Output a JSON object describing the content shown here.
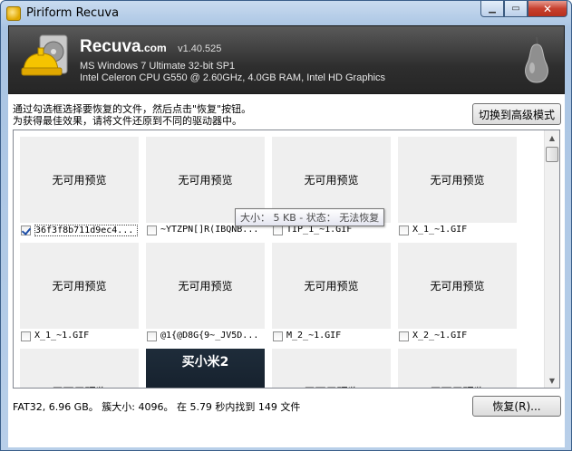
{
  "window": {
    "title": "Piriform Recuva"
  },
  "header": {
    "brand_name": "Recuva",
    "brand_domain": ".com",
    "version": "v1.40.525",
    "os_line": "MS Windows 7 Ultimate 32-bit SP1",
    "hw_line": "Intel Celeron CPU G550 @ 2.60GHz, 4.0GB RAM, Intel HD Graphics"
  },
  "instructions": {
    "line1": "通过勾选框选择要恢复的文件，然后点击\"恢复\"按钮。",
    "line2": "为获得最佳效果，请将文件还原到不同的驱动器中。"
  },
  "advanced_button_label": "切换到高级模式",
  "tiles": [
    {
      "preview": "无可用预览",
      "filename": "36f3f8b711d9ec4...",
      "checked": true,
      "selected": true
    },
    {
      "preview": "无可用预览",
      "filename": "~YTZPN[]R(IBQNB...",
      "checked": false
    },
    {
      "preview": "无可用预览",
      "filename": "TIP_1_~1.GIF",
      "checked": false
    },
    {
      "preview": "无可用预览",
      "filename": "X_1_~1.GIF",
      "checked": false
    },
    {
      "preview": "无可用预览",
      "filename": "X_1_~1.GIF",
      "checked": false
    },
    {
      "preview": "无可用预览",
      "filename": "@1{@D8G{9~_JV5D...",
      "checked": false
    },
    {
      "preview": "无可用预览",
      "filename": "M_2_~1.GIF",
      "checked": false
    },
    {
      "preview": "无可用预览",
      "filename": "X_2_~1.GIF",
      "checked": false
    },
    {
      "preview": "无可用预览"
    },
    {
      "preview": "买小米2",
      "kind": "image"
    },
    {
      "preview": "无可用预览"
    },
    {
      "preview": "无可用预览"
    }
  ],
  "tooltip": "大小： 5 KB - 状态： 无法恢复",
  "status_text": "FAT32, 6.96 GB。 簇大小: 4096。 在 5.79 秒内找到 149 文件",
  "recover_button_label": "恢复(R)...",
  "colors": {
    "header_bg": "#2e2e2e",
    "accent_yellow": "#f5c400",
    "window_frame": "#b8cfe9"
  }
}
